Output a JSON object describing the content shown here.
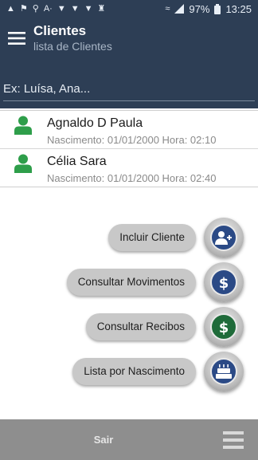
{
  "status_bar": {
    "battery": "97%",
    "time": "13:25"
  },
  "header": {
    "title": "Clientes",
    "subtitle": "lista de Clientes"
  },
  "search": {
    "placeholder": "Ex: Luísa, Ana..."
  },
  "clients": [
    {
      "name": "Agnaldo D Paula",
      "info": "Nascimento: 01/01/2000 Hora: 02:10"
    },
    {
      "name": "Célia Sara",
      "info": "Nascimento: 01/01/2000 Hora: 02:40"
    }
  ],
  "actions": [
    {
      "label": "Incluir Cliente",
      "icon": "add-user-icon",
      "color": "#2b4a86"
    },
    {
      "label": "Consultar Movimentos",
      "icon": "dollar-icon",
      "color": "#2b4a86"
    },
    {
      "label": "Consultar Recibos",
      "icon": "dollar-icon",
      "color": "#1f6b3a"
    },
    {
      "label": "Lista por Nascimento",
      "icon": "birthday-cake-icon",
      "color": "#2b4a86"
    }
  ],
  "bottom_bar": {
    "exit_label": "Sair"
  },
  "colors": {
    "header_bg": "#2d3e55",
    "client_icon": "#2e9e4a",
    "bottom_bar": "#8e8e8e"
  }
}
